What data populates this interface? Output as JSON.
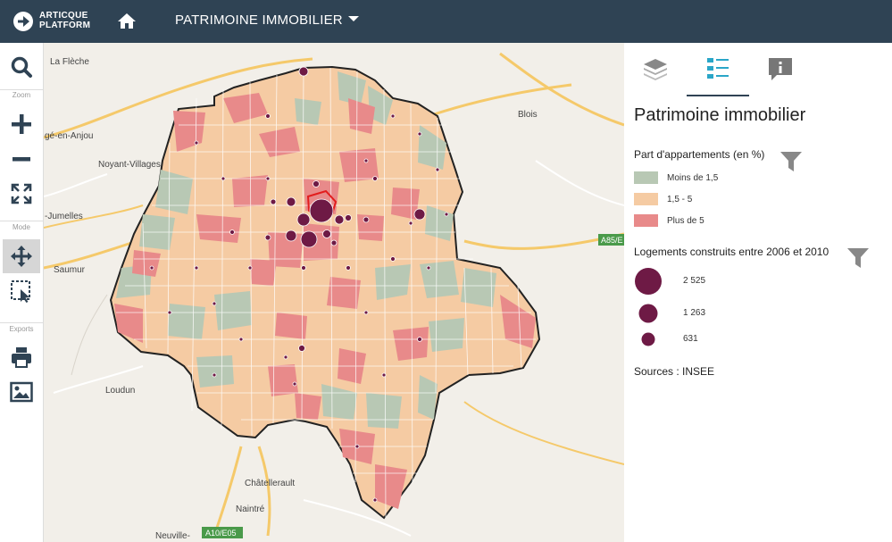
{
  "header": {
    "logo_line1": "ARTICQUE",
    "logo_line2": "PLATFORM",
    "project_title": "PATRIMOINE IMMOBILIER"
  },
  "toolbar": {
    "zoom_label": "Zoom",
    "mode_label": "Mode",
    "exports_label": "Exports",
    "tools": [
      "search-icon",
      "zoom-in-icon",
      "zoom-out-icon",
      "fit-extent-icon",
      "pan-move-icon",
      "selection-icon",
      "print-icon",
      "image-export-icon"
    ],
    "active_tool": "pan-move-icon"
  },
  "map": {
    "places": {
      "la_fleche": "La Flèche",
      "angers_area": "gé-en-Anjou",
      "noyant": "Noyant-Villages",
      "jumelles": "-Jumelles",
      "saumur": "Saumur",
      "loudun": "Loudun",
      "chatellerault": "Châtellerault",
      "naintre": "Naintré",
      "neuville": "Neuville-",
      "blois": "Blois"
    },
    "roads": {
      "a85": "A85/E",
      "a10": "A10/E05"
    }
  },
  "panel": {
    "tabs": [
      "layers-icon",
      "legend-icon",
      "info-icon"
    ],
    "active_tab": "legend-icon",
    "title": "Patrimoine immobilier",
    "choropleth": {
      "title": "Part d'appartements (en %)",
      "classes": [
        {
          "label": "Moins de 1,5",
          "color": "#b8c8b4"
        },
        {
          "label": "1,5 - 5",
          "color": "#f5cba3"
        },
        {
          "label": "Plus de 5",
          "color": "#e88a8a"
        }
      ]
    },
    "proportional": {
      "title": "Logements construits entre 2006 et 2010",
      "color": "#6e1a45",
      "values": [
        "2 525",
        "1 263",
        "631"
      ]
    },
    "sources": "Sources : INSEE"
  },
  "colors": {
    "header_bg": "#2f4354",
    "accent": "#2f4354",
    "circle": "#6e1a45",
    "highway": "#f5c96a"
  }
}
